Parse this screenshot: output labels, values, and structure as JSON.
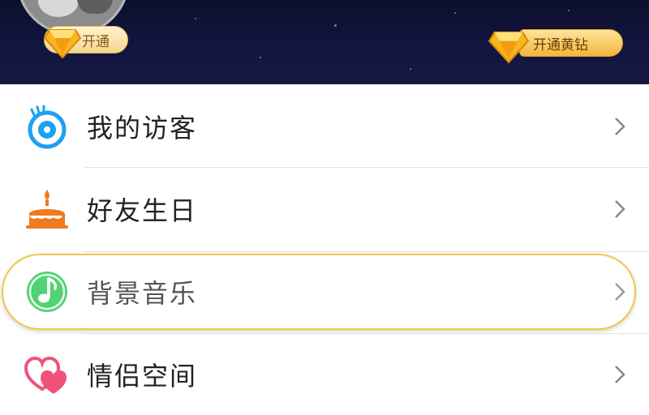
{
  "header": {
    "vip_badge_label": "开通",
    "yellow_diamond_button_label": "开通黄钻"
  },
  "menu": {
    "items": [
      {
        "label": "我的访客",
        "icon": "visitor-eye-icon"
      },
      {
        "label": "好友生日",
        "icon": "birthday-cake-icon"
      },
      {
        "label": "背景音乐",
        "icon": "music-note-icon"
      },
      {
        "label": "情侣空间",
        "icon": "hearts-icon"
      }
    ]
  },
  "colors": {
    "header_bg": "#121540",
    "highlight_border": "#f2c64a",
    "visitor_icon": "#1da1f2",
    "cake_icon": "#f07a1e",
    "music_icon": "#3ec760",
    "hearts_icon": "#f0527a"
  }
}
